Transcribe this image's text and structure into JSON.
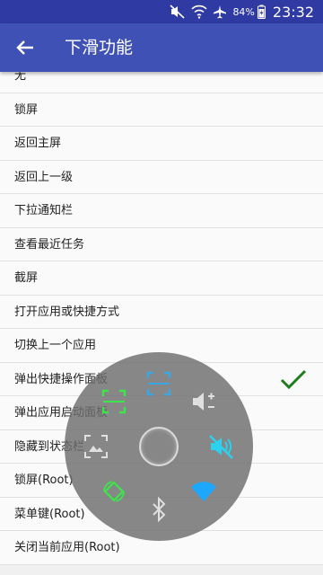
{
  "status_bar": {
    "battery": "84%",
    "time": "23:32"
  },
  "app_bar": {
    "title": "下滑功能"
  },
  "list": [
    {
      "label": "无"
    },
    {
      "label": "锁屏"
    },
    {
      "label": "返回主屏"
    },
    {
      "label": "返回上一级"
    },
    {
      "label": "下拉通知栏"
    },
    {
      "label": "查看最近任务"
    },
    {
      "label": "截屏"
    },
    {
      "label": "打开应用或快捷方式"
    },
    {
      "label": "切换上一个应用"
    },
    {
      "label": "弹出快捷操作面板",
      "selected": true
    },
    {
      "label": "弹出应用启动面板"
    },
    {
      "label": "隐藏到状态栏"
    },
    {
      "label": "锁屏(Root)"
    },
    {
      "label": "菜单键(Root)"
    },
    {
      "label": "关闭当前应用(Root)"
    }
  ],
  "panel_actions": [
    {
      "icon": "scan-frame-icon",
      "color": "#3aa7e0"
    },
    {
      "icon": "volume-adjust-icon",
      "color": "#e0e0e0"
    },
    {
      "icon": "mute-icon",
      "color": "#2bd2f0"
    },
    {
      "icon": "wifi-icon",
      "color": "#1ea7ff"
    },
    {
      "icon": "bluetooth-icon",
      "color": "#e0e0e0"
    },
    {
      "icon": "rotate-icon",
      "color": "#3ce54a"
    },
    {
      "icon": "image-icon",
      "color": "#e0e0e0"
    },
    {
      "icon": "screenshot-icon",
      "color": "#3ce54a"
    }
  ],
  "colors": {
    "app_bar": "#3f51b5",
    "status_bar": "#2f3aa3",
    "check": "#1e7b1e"
  }
}
